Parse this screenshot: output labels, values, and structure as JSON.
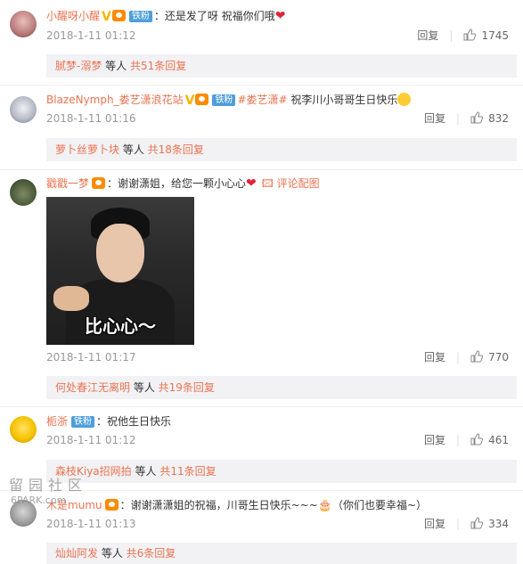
{
  "comments": [
    {
      "user": "小醒呀小醒",
      "fan_badge": "铁粉",
      "text": "：还是发了呀 祝福你们哦",
      "time": "2018-1-11 01:12",
      "reply_label": "回复",
      "likes": "1745",
      "replies": {
        "who": "腻梦-溺梦",
        "etc": " 等人 ",
        "total": "共51条回复"
      }
    },
    {
      "user": "BlazeNymph_娄艺潇浪花站",
      "fan_badge": "铁粉",
      "topic": "#娄艺潇#",
      "text": " 祝李川小哥哥生日快乐",
      "time": "2018-1-11 01:16",
      "reply_label": "回复",
      "likes": "832",
      "replies": {
        "who": "萝卜丝萝卜块",
        "etc": " 等人 ",
        "total": "共18条回复"
      }
    },
    {
      "user": "戳戳一梦",
      "text": "：谢谢潇姐，给您一颗小心心",
      "image_link": "评论配图",
      "image_caption": "比心心～",
      "time": "2018-1-11 01:17",
      "reply_label": "回复",
      "likes": "770",
      "replies": {
        "who": "何处春江无离明",
        "etc": " 等人 ",
        "total": "共19条回复"
      }
    },
    {
      "user": "栀浙",
      "fan_badge": "铁粉",
      "text": "：祝他生日快乐",
      "time": "2018-1-11 01:12",
      "reply_label": "回复",
      "likes": "461",
      "replies": {
        "who": "森枝Kiya招网拍",
        "etc": " 等人 ",
        "total": "共11条回复"
      }
    },
    {
      "user": "木是mumu",
      "text": "：谢谢潇潇姐的祝福，川哥生日快乐~~~",
      "text_after": "（你们也要幸福~）",
      "time": "2018-1-11 01:13",
      "reply_label": "回复",
      "likes": "334",
      "replies": {
        "who": "灿灿阿发",
        "etc": " 等人 ",
        "total": "共6条回复"
      }
    }
  ],
  "watermark": {
    "line1": "留园社区",
    "line2": "6PARK.com"
  },
  "colors": {
    "name": "#eb7350",
    "fan_badge": "#4d9eda",
    "reply_bg": "#f2f2f5",
    "heart": "#e0243b"
  }
}
